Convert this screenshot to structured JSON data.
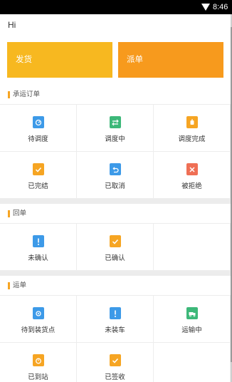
{
  "status_bar": {
    "time": "8:46",
    "wifi_icon": "wifi-icon"
  },
  "header": {
    "greeting": "Hi"
  },
  "actions": {
    "ship_label": "发货",
    "dispatch_label": "派单"
  },
  "colors": {
    "yellow": "#f7b820",
    "orange": "#f79a1d",
    "accent": "#f6a523",
    "blue": "#3d9ae8",
    "green": "#3db879",
    "red": "#ef6f55"
  },
  "sections": {
    "orders": {
      "title": "承运订单",
      "items": [
        {
          "label": "待调度",
          "icon": "pending-dispatch-icon"
        },
        {
          "label": "调度中",
          "icon": "dispatching-icon"
        },
        {
          "label": "调度完成",
          "icon": "dispatch-done-icon"
        },
        {
          "label": "已完结",
          "icon": "completed-icon"
        },
        {
          "label": "已取消",
          "icon": "cancelled-icon"
        },
        {
          "label": "被拒绝",
          "icon": "rejected-icon"
        }
      ]
    },
    "receipts": {
      "title": "回单",
      "items": [
        {
          "label": "未确认",
          "icon": "unconfirmed-icon"
        },
        {
          "label": "已确认",
          "icon": "confirmed-icon"
        }
      ]
    },
    "waybills": {
      "title": "运单",
      "items": [
        {
          "label": "待到装货点",
          "icon": "pickup-location-icon"
        },
        {
          "label": "未装车",
          "icon": "not-loaded-icon"
        },
        {
          "label": "运输中",
          "icon": "in-transit-icon"
        },
        {
          "label": "已到站",
          "icon": "arrived-icon"
        },
        {
          "label": "已签收",
          "icon": "signed-icon"
        }
      ]
    }
  }
}
